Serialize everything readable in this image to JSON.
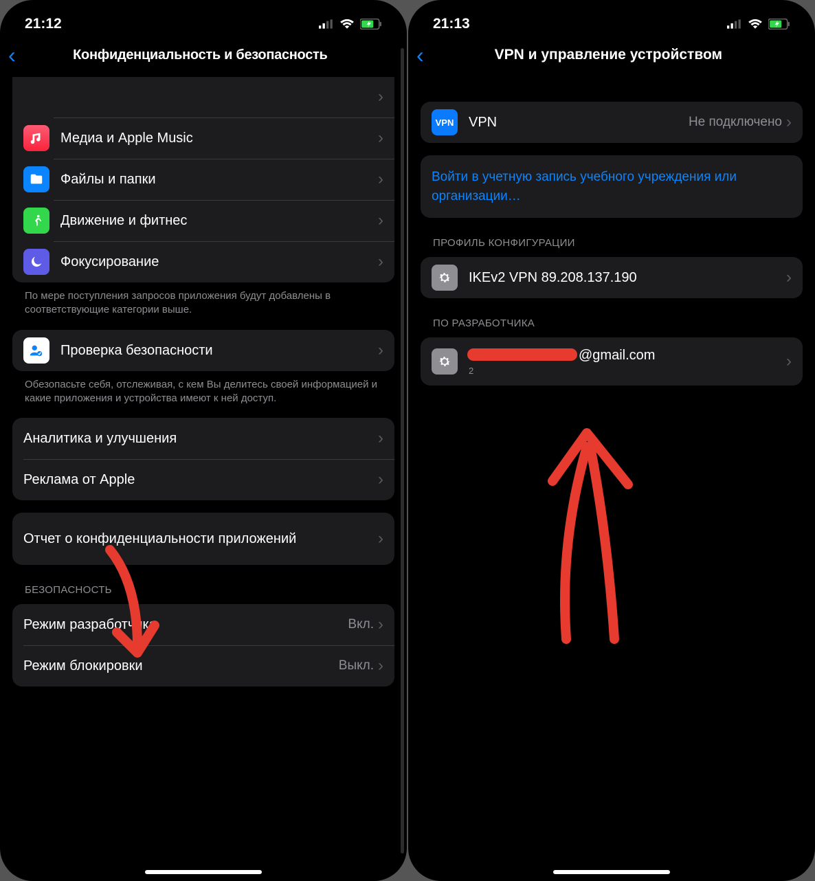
{
  "left": {
    "status_time": "21:12",
    "nav_title": "Конфиденциальность и безопасность",
    "group1": [
      {
        "name": "media",
        "icon": "music",
        "label": "Медиа и Apple Music"
      },
      {
        "name": "files",
        "icon": "files",
        "label": "Файлы и папки"
      },
      {
        "name": "motion",
        "icon": "motion",
        "label": "Движение и фитнес"
      },
      {
        "name": "focus",
        "icon": "focus",
        "label": "Фокусирование"
      }
    ],
    "group1_footer": "По мере поступления запросов приложения будут добавлены в соответствующие категории выше.",
    "group2": [
      {
        "name": "safety-check",
        "icon": "safety",
        "label": "Проверка безопасности"
      }
    ],
    "group2_footer": "Обезопасьте себя, отслеживая, с кем Вы делитесь своей информацией и какие приложения и устройства имеют к ней доступ.",
    "group3": [
      {
        "name": "analytics",
        "label": "Аналитика и улучшения"
      },
      {
        "name": "apple-ads",
        "label": "Реклама от Apple"
      }
    ],
    "group4": [
      {
        "name": "app-privacy-report",
        "label": "Отчет о конфиденциальности приложений"
      }
    ],
    "security_header": "БЕЗОПАСНОСТЬ",
    "group5": [
      {
        "name": "developer-mode",
        "label": "Режим разработчика",
        "detail": "Вкл."
      },
      {
        "name": "lockdown-mode",
        "label": "Режим блокировки",
        "detail": "Выкл."
      }
    ]
  },
  "right": {
    "status_time": "21:13",
    "nav_title": "VPN и управление устройством",
    "vpn_group": [
      {
        "name": "vpn",
        "icon": "vpn",
        "icon_text": "VPN",
        "label": "VPN",
        "detail": "Не подключено"
      }
    ],
    "signin_link": "Войти в учетную запись учебного учреждения или организации…",
    "config_header": "ПРОФИЛЬ КОНФИГУРАЦИИ",
    "config_group": [
      {
        "name": "ikev2-profile",
        "icon": "gear",
        "label": "IKEv2 VPN 89.208.137.190"
      }
    ],
    "dev_header": "ПО РАЗРАБОТЧИКА",
    "dev_group": [
      {
        "name": "developer-app",
        "icon": "gear",
        "label": "@gmail.com",
        "sub": "2",
        "redacted": true
      }
    ]
  }
}
